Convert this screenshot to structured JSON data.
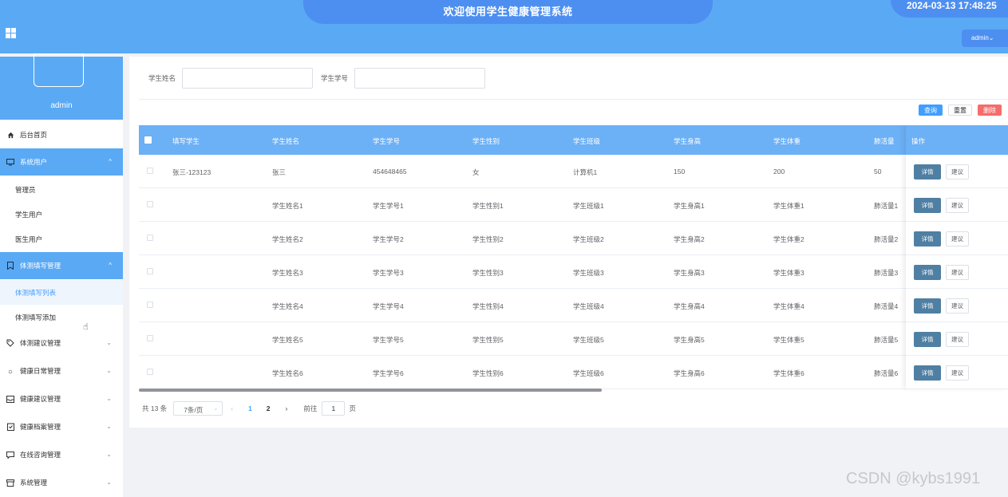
{
  "header": {
    "title": "欢迎使用学生健康管理系统",
    "datetime": "2024-03-13 17:48:25",
    "user_menu": "admin⌄"
  },
  "sidebar": {
    "username": "admin",
    "items": [
      {
        "label": "后台首页",
        "icon": "home-icon"
      },
      {
        "label": "系统用户",
        "icon": "monitor-icon",
        "expanded": true
      },
      {
        "label": "体测填写管理",
        "icon": "bookmark-icon",
        "expanded": true
      },
      {
        "label": "体测建议管理",
        "icon": "tag-icon"
      },
      {
        "label": "健康日常管理",
        "icon": "sun-icon"
      },
      {
        "label": "健康建议管理",
        "icon": "inbox-icon"
      },
      {
        "label": "健康档案管理",
        "icon": "clipboard-icon"
      },
      {
        "label": "在线咨询管理",
        "icon": "chat-icon"
      },
      {
        "label": "系统管理",
        "icon": "box-icon"
      }
    ],
    "system_users_sub": [
      "管理员",
      "学生用户",
      "医生用户"
    ],
    "fill_sub": [
      "体测填写列表",
      "体测填写添加"
    ]
  },
  "search": {
    "name_label": "学生姓名",
    "id_label": "学生学号",
    "name_value": "",
    "id_value": ""
  },
  "actions": {
    "query": "查询",
    "reset": "重置",
    "delete": "删除"
  },
  "table": {
    "columns": [
      "填写学生",
      "学生姓名",
      "学生学号",
      "学生性别",
      "学生班级",
      "学生身高",
      "学生体重",
      "肺活量"
    ],
    "op_header": "操作",
    "detail_label": "详情",
    "suggest_label": "建议",
    "rows": [
      [
        "张三-123123",
        "张三",
        "454648465",
        "女",
        "计算机1",
        "150",
        "200",
        "50"
      ],
      [
        "",
        "学生姓名1",
        "学生学号1",
        "学生性别1",
        "学生班级1",
        "学生身高1",
        "学生体重1",
        "肺活量1"
      ],
      [
        "",
        "学生姓名2",
        "学生学号2",
        "学生性别2",
        "学生班级2",
        "学生身高2",
        "学生体重2",
        "肺活量2"
      ],
      [
        "",
        "学生姓名3",
        "学生学号3",
        "学生性别3",
        "学生班级3",
        "学生身高3",
        "学生体重3",
        "肺活量3"
      ],
      [
        "",
        "学生姓名4",
        "学生学号4",
        "学生性别4",
        "学生班级4",
        "学生身高4",
        "学生体重4",
        "肺活量4"
      ],
      [
        "",
        "学生姓名5",
        "学生学号5",
        "学生性别5",
        "学生班级5",
        "学生身高5",
        "学生体重5",
        "肺活量5"
      ],
      [
        "",
        "学生姓名6",
        "学生学号6",
        "学生性别6",
        "学生班级6",
        "学生身高6",
        "学生体重6",
        "肺活量6"
      ]
    ]
  },
  "pagination": {
    "total": "共 13 条",
    "page_size": "7条/页",
    "pages": [
      "1",
      "2"
    ],
    "current": "1",
    "goto_label": "前往",
    "goto_value": "1",
    "page_suffix": "页"
  },
  "watermark": "CSDN @kybs1991",
  "colors": {
    "primary": "#5aa9f5",
    "header_pill": "#4d8ff0",
    "table_head": "#6cb0f5",
    "detail_btn": "#4f7fa3",
    "danger": "#f56c6c"
  }
}
